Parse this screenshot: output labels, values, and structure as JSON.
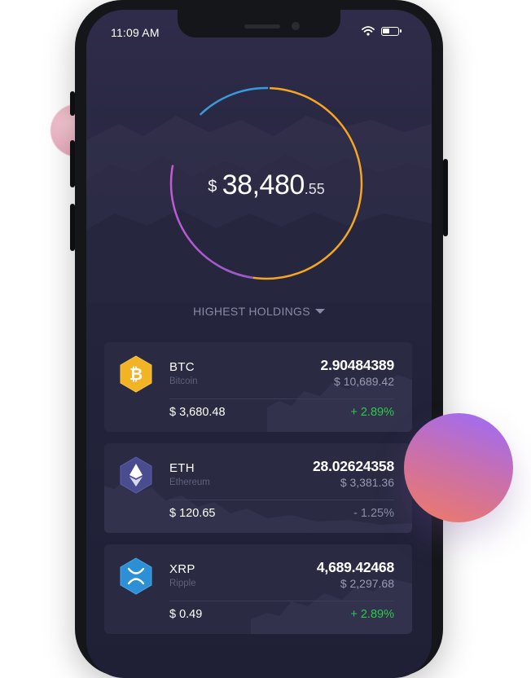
{
  "status_bar": {
    "time": "11:09  AM",
    "battery_level": 0.45
  },
  "balance": {
    "currency": "$",
    "integer": "38,480",
    "decimal": ".55"
  },
  "holdings_label": "HIGHEST HOLDINGS",
  "colors": {
    "btc": "#f2b324",
    "eth": "#4a4c8f",
    "xrp": "#2d8fd6",
    "positive": "#2ec94a",
    "negative": "#8c8ca6",
    "ring_orange": "#f5a623",
    "ring_purple": "#a45fd6",
    "ring_blue": "#3a9bdc"
  },
  "coins": [
    {
      "symbol": "BTC",
      "name": "Bitcoin",
      "amount": "2.90484389",
      "price": "$ 10,689.42",
      "value": "$ 3,680.48",
      "change": "+ 2.89%",
      "trend": "up",
      "icon": "bitcoin-icon"
    },
    {
      "symbol": "ETH",
      "name": "Ethereum",
      "amount": "28.02624358",
      "price": "$ 3,381.36",
      "value": "$ 120.65",
      "change": "- 1.25%",
      "trend": "down",
      "icon": "ethereum-icon"
    },
    {
      "symbol": "XRP",
      "name": "Ripple",
      "amount": "4,689.42468",
      "price": "$ 2,297.68",
      "value": "$ 0.49",
      "change": "+ 2.89%",
      "trend": "up",
      "icon": "ripple-icon"
    }
  ]
}
